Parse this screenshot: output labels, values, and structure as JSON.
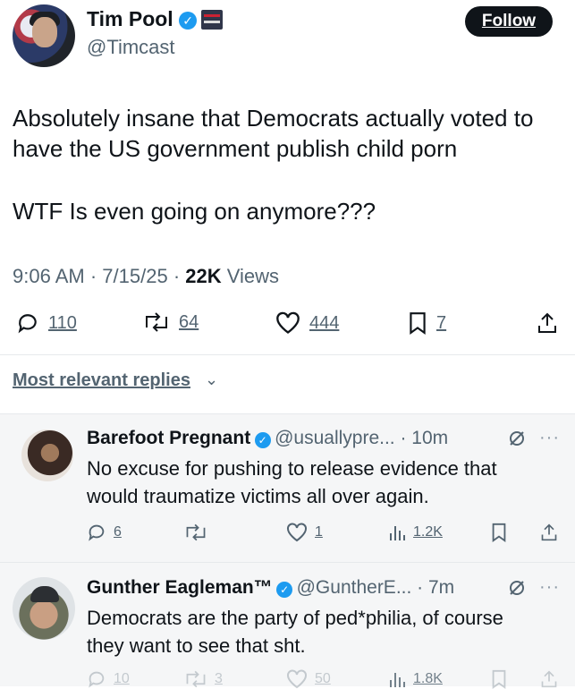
{
  "tweet": {
    "author_name": "Tim Pool",
    "author_handle": "@Timcast",
    "verified_icon": "check",
    "follow_label": "Follow",
    "text_line1": "Absolutely insane that Democrats actually voted to",
    "text_line2": "have the US government publish child porn",
    "text_line3": "WTF Is even going on anymore???",
    "time": "9:06 AM",
    "date": "7/15/25",
    "views_count": "22K",
    "views_label": "Views",
    "sep": "·",
    "replies": "110",
    "reposts": "64",
    "likes": "444",
    "bookmarks": "7"
  },
  "replies_header": {
    "label": "Most relevant replies",
    "chevron": "⌄"
  },
  "replies": [
    {
      "name": "Barefoot Pregnant",
      "handle_time": "@usuallypre... · 10m",
      "line1": "No excuse for pushing to release evidence that",
      "line2": "would traumatize victims all over again.",
      "replies": "6",
      "reposts": "",
      "likes": "1",
      "views": "1.2K"
    },
    {
      "name": "Gunther Eagleman™",
      "handle_time": "@GuntherE... · 7m",
      "line1": "Democrats are the party of ped*philia, of course",
      "line2": "they want to see that sht.",
      "replies": "10",
      "reposts": "3",
      "likes": "50",
      "views": "1.8K"
    }
  ],
  "colors": {
    "text": "#0f1419",
    "secondary": "#536471",
    "verified": "#1d9bf0",
    "follow_bg": "#0f1419"
  }
}
